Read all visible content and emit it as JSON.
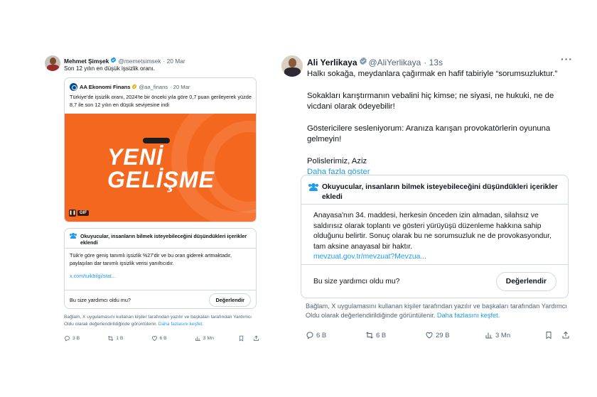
{
  "tweet1": {
    "name": "Mehmet Şimşek",
    "handle": "@memetsimsek",
    "time": "· 20 Mar",
    "text": "Son 12 yılın en düşük işsizlik oranı.",
    "quote": {
      "name": "AA Ekonomi Finans",
      "handle": "@aa_finans",
      "time": "· 20 Mar",
      "text": "Türkiye'de işsizlik oranı, 2024'te bir önceki yıla göre 0,7 puan gerileyerek yüzde 8,7 ile son 12 yılın en düşük seviyesine indi",
      "image_headline_1": "YENİ",
      "image_headline_2": "GELİŞME",
      "gif_label": "GIF"
    },
    "note": {
      "title": "Okuyucular, insanların bilmek isteyebileceğini düşündükleri içerikler eklendi",
      "body": "Tüik'e göre geniş tanımlı işsizlik %27'dir ve bu oran giderek artmaktadır, paylaşılan dar tanımlı işsizlik verisi yanıltıcıdır.",
      "link": "x.com/tuikbilgi/stat...",
      "question": "Bu size yardımcı oldu mu?",
      "button": "Değerlendir"
    },
    "disclaimer": "Bağlam, X uygulamasını kullanan kişiler tarafından yazılır ve başkaları tarafından Yardımcı Oldu olarak değerlendirildiğinde görüntülenir.",
    "disclaimer_link": "Daha fazlasını keşfet.",
    "actions": {
      "replies": "3 B",
      "reposts": "1 B",
      "likes": "6 B",
      "views": "3 Mn"
    }
  },
  "tweet2": {
    "name": "Ali Yerlikaya",
    "handle": "@AliYerlikaya",
    "time": "· 13s",
    "paragraphs": [
      "Halkı sokağa, meydanlara çağırmak en hafif tabiriyle “sorumsuzluktur.”",
      "Sokakları karıştırmanın vebalini hiç kimse; ne siyasi, ne hukuki, ne de vicdani olarak ödeyebilir!",
      "Göstericilere sesleniyorum: Aranıza karışan provokatörlerin oyununa gelmeyin!",
      "Polislerimiz, Aziz"
    ],
    "show_more": "Daha fazla göster",
    "note": {
      "title": "Okuyucular, insanların bilmek isteyebileceğini düşündükleri içerikler ekledi",
      "body": "Anayasa'nın 34. maddesi, herkesin önceden izin almadan, silahsız ve saldırısız olarak toplantı ve gösteri yürüyüşü düzenleme hakkına sahip olduğunu belirtir. Sonuç olarak bu ne sorumsuzluk ne de provokasyondur, tam aksine anayasal bir haktır.",
      "link": "mevzuat.gov.tr/mevzuat?Mevzua...",
      "question": "Bu size yardımcı oldu mu?",
      "button": "Değerlendir"
    },
    "disclaimer": "Bağlam, X uygulamasını kullanan kişiler tarafından yazılır ve başkaları tarafından Yardımcı Oldu olarak değerlendirildiğinde görüntülenir.",
    "disclaimer_link": "Daha fazlasını keşfet.",
    "actions": {
      "replies": "6 B",
      "reposts": "6 B",
      "likes": "29 B",
      "views": "3 Mn"
    }
  },
  "colors": {
    "accent": "#1d9bf0",
    "orange": "#f4671f",
    "muted": "#536471",
    "border": "#cfd9de"
  },
  "icons": [
    "verified-badge-icon",
    "more-icon",
    "reply-icon",
    "repost-icon",
    "like-icon",
    "views-icon",
    "bookmark-icon",
    "share-icon",
    "community-notes-icon",
    "pause-icon"
  ]
}
